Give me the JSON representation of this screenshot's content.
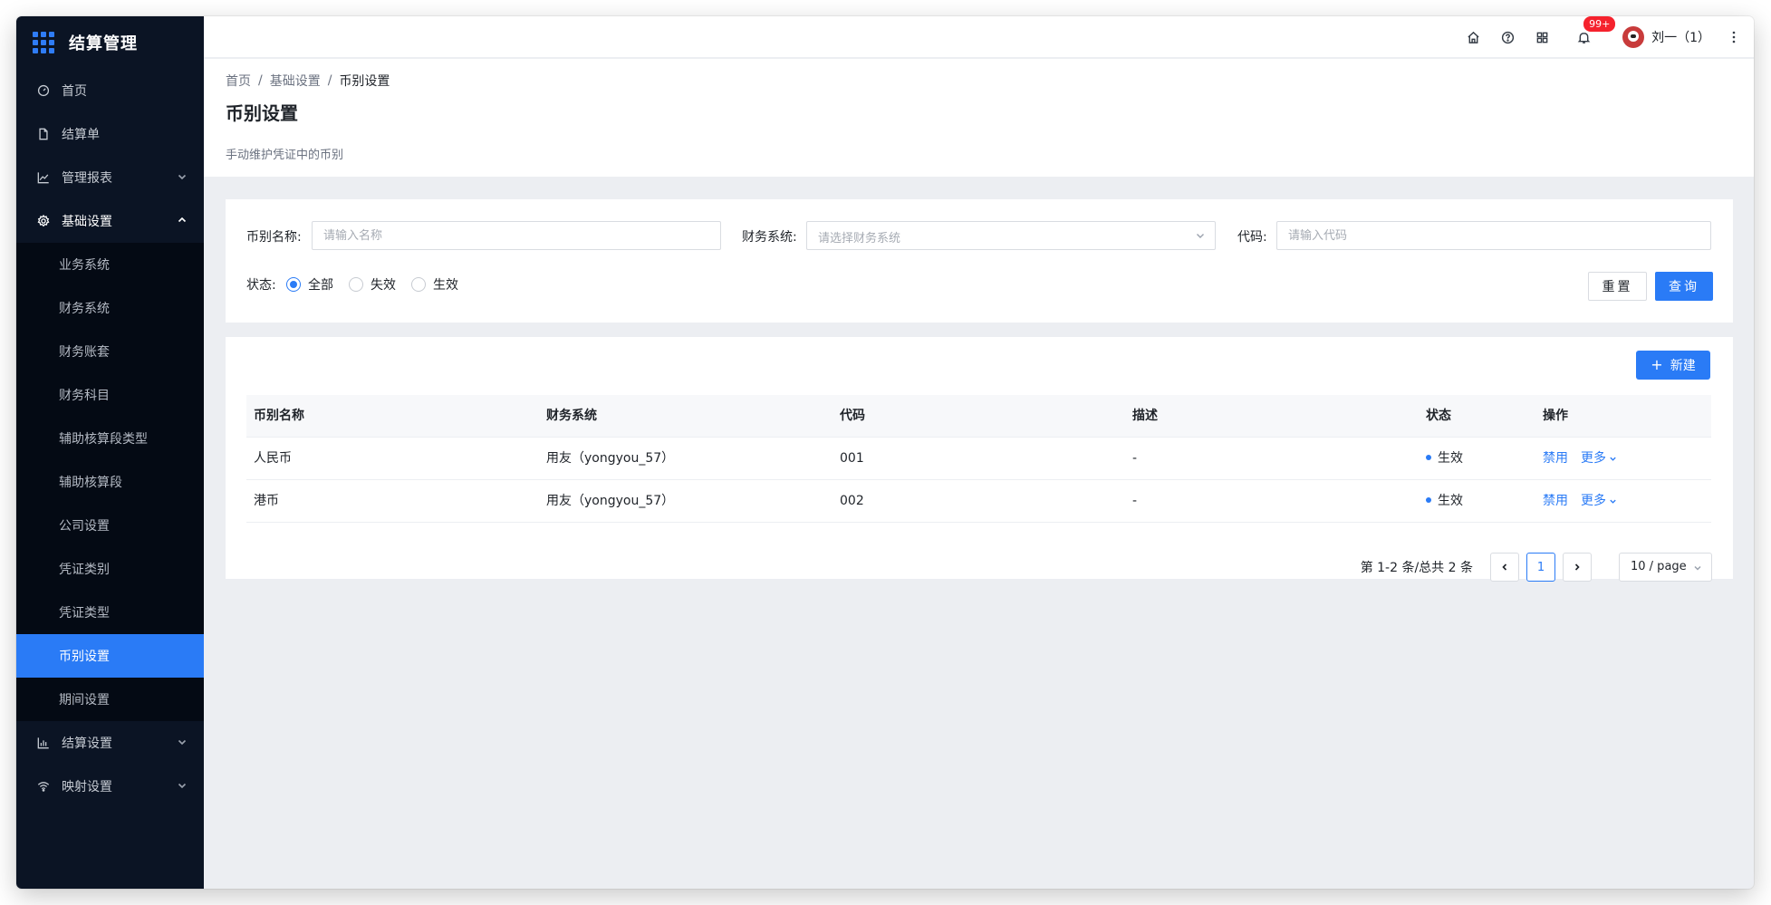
{
  "app": {
    "title": "结算管理"
  },
  "sidebar": {
    "items": [
      {
        "label": "首页",
        "icon": "dashboard-icon"
      },
      {
        "label": "结算单",
        "icon": "file-icon"
      },
      {
        "label": "管理报表",
        "icon": "line-chart-icon",
        "expandable": true
      },
      {
        "label": "基础设置",
        "icon": "settings-icon",
        "expandable": true,
        "open": true
      }
    ],
    "submenu": [
      {
        "label": "业务系统"
      },
      {
        "label": "财务系统"
      },
      {
        "label": "财务账套"
      },
      {
        "label": "财务科目"
      },
      {
        "label": "辅助核算段类型"
      },
      {
        "label": "辅助核算段"
      },
      {
        "label": "公司设置"
      },
      {
        "label": "凭证类别"
      },
      {
        "label": "凭证类型"
      },
      {
        "label": "币别设置",
        "active": true
      },
      {
        "label": "期间设置"
      }
    ],
    "items_after": [
      {
        "label": "结算设置",
        "icon": "bar-chart-icon",
        "expandable": true
      },
      {
        "label": "映射设置",
        "icon": "wifi-icon",
        "expandable": true
      }
    ]
  },
  "header": {
    "notifications_badge": "99+",
    "user_name": "刘一（1）"
  },
  "page": {
    "breadcrumb": [
      "首页",
      "基础设置",
      "币别设置"
    ],
    "breadcrumb_sep": "/",
    "title": "币别设置",
    "description": "手动维护凭证中的币别"
  },
  "filters": {
    "name_label": "币别名称:",
    "name_placeholder": "请输入名称",
    "system_label": "财务系统:",
    "system_placeholder": "请选择财务系统",
    "code_label": "代码:",
    "code_placeholder": "请输入代码",
    "status_label": "状态:",
    "status_options": [
      "全部",
      "失效",
      "生效"
    ],
    "status_selected": "全部",
    "reset_label": "重置",
    "query_label": "查询"
  },
  "table": {
    "new_button": "新建",
    "columns": [
      "币别名称",
      "财务系统",
      "代码",
      "描述",
      "状态",
      "操作"
    ],
    "rows": [
      {
        "name": "人民币",
        "system": "用友（yongyou_57）",
        "code": "001",
        "desc": "-",
        "status": "生效",
        "action": "禁用",
        "more": "更多"
      },
      {
        "name": "港币",
        "system": "用友（yongyou_57）",
        "code": "002",
        "desc": "-",
        "status": "生效",
        "action": "禁用",
        "more": "更多"
      }
    ]
  },
  "pagination": {
    "total_text": "第 1-2 条/总共 2 条",
    "current_page": "1",
    "page_size": "10 / page"
  },
  "colors": {
    "primary": "#2a7bf6",
    "sidebar_bg": "#0b1424",
    "badge": "#f5222d"
  }
}
